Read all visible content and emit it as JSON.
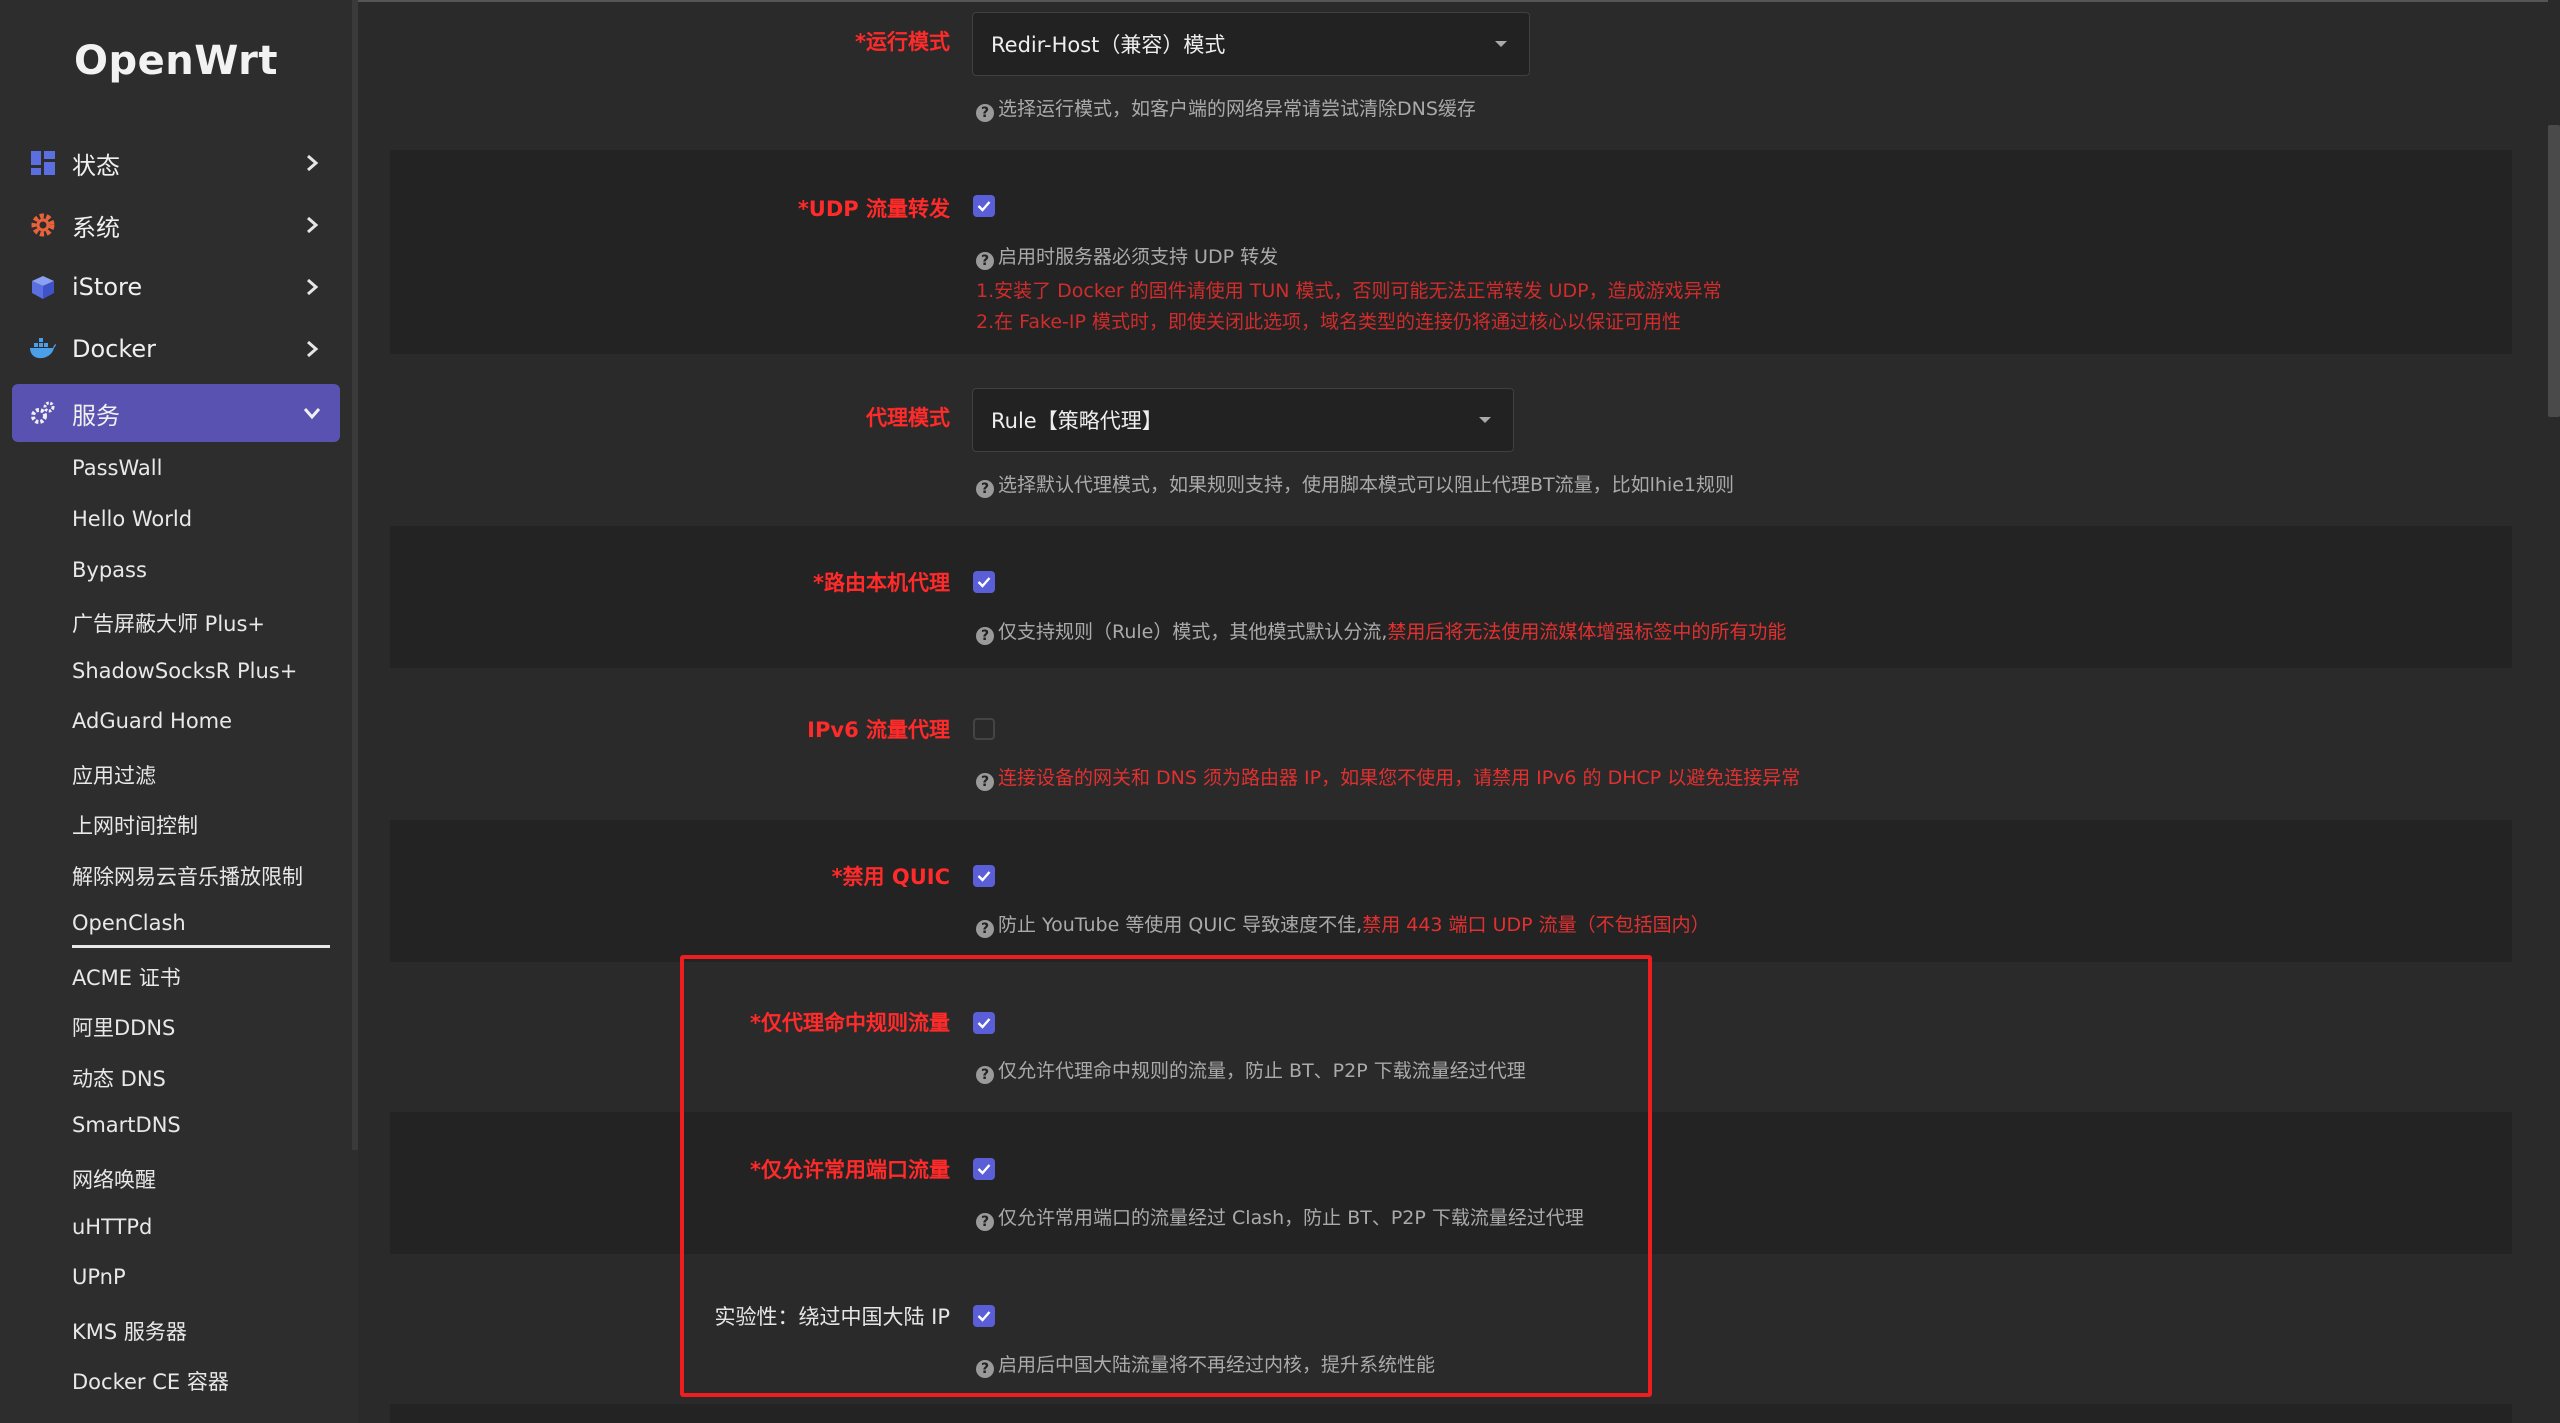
{
  "sidebar": {
    "logo": "OpenWrt",
    "main_items": [
      {
        "label": "状态",
        "icon": "dashboard-icon"
      },
      {
        "label": "系统",
        "icon": "gear-icon"
      },
      {
        "label": "iStore",
        "icon": "cube-icon"
      },
      {
        "label": "Docker",
        "icon": "docker-icon"
      },
      {
        "label": "服务",
        "icon": "services-gears-icon",
        "active": true
      }
    ],
    "sub_items": [
      "PassWall",
      "Hello World",
      "Bypass",
      "广告屏蔽大师 Plus+",
      "ShadowSocksR Plus+",
      "AdGuard Home",
      "应用过滤",
      "上网时间控制",
      "解除网易云音乐播放限制",
      "OpenClash",
      "ACME 证书",
      "阿里DDNS",
      "动态 DNS",
      "SmartDNS",
      "网络唤醒",
      "uHTTPd",
      "UPnP",
      "KMS 服务器",
      "Docker CE 容器"
    ],
    "selected_sub": "OpenClash",
    "active_color": "#5a52b0"
  },
  "form": {
    "run_mode": {
      "label": "*运行模式",
      "value": "Redir-Host（兼容）模式",
      "help": "选择运行模式，如客户端的网络异常请尝试清除DNS缓存"
    },
    "udp_forward": {
      "label": "*UDP 流量转发",
      "checked": true,
      "help": "启用时服务器必须支持 UDP 转发",
      "warning_1": "1.安装了 Docker 的固件请使用 TUN 模式，否则可能无法正常转发 UDP，造成游戏异常",
      "warning_2": "2.在 Fake-IP 模式时，即使关闭此选项，域名类型的连接仍将通过核心以保证可用性"
    },
    "proxy_mode": {
      "label": "代理模式",
      "value": "Rule【策略代理】",
      "help": "选择默认代理模式，如果规则支持，使用脚本模式可以阻止代理BT流量，比如lhie1规则"
    },
    "router_self_proxy": {
      "label": "*路由本机代理",
      "checked": true,
      "help_plain": "仅支持规则（Rule）模式，其他模式默认分流,",
      "help_red": "禁用后将无法使用流媒体增强标签中的所有功能"
    },
    "ipv6_proxy": {
      "label": "IPv6 流量代理",
      "checked": false,
      "help_red": "连接设备的网关和 DNS 须为路由器 IP，如果您不使用，请禁用 IPv6 的 DHCP 以避免连接异常"
    },
    "disable_quic": {
      "label": "*禁用 QUIC",
      "checked": true,
      "help_plain": "防止 YouTube 等使用 QUIC 导致速度不佳,",
      "help_red": "禁用 443 端口 UDP 流量（不包括国内）"
    },
    "rule_only": {
      "label": "*仅代理命中规则流量",
      "checked": true,
      "help": "仅允许代理命中规则的流量，防止 BT、P2P 下载流量经过代理"
    },
    "common_ports_only": {
      "label": "*仅允许常用端口流量",
      "checked": true,
      "help": "仅允许常用端口的流量经过 Clash，防止 BT、P2P 下载流量经过代理"
    },
    "bypass_cn": {
      "label": "实验性：绕过中国大陆 IP",
      "checked": true,
      "help": "启用后中国大陆流量将不再经过内核，提升系统性能"
    }
  },
  "colors": {
    "required_label": "#ff2a2a",
    "checkbox": "#5a5fd8",
    "highlight_box": "#ee1e1e"
  }
}
